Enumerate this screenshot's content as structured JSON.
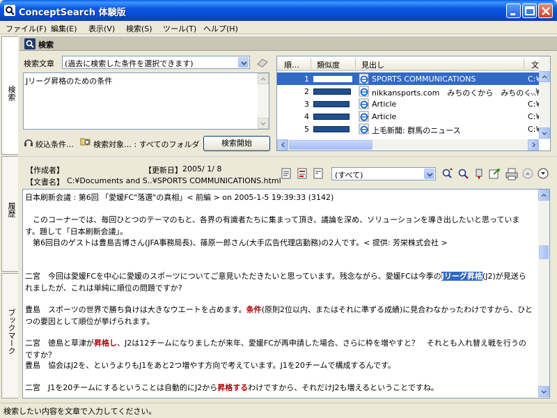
{
  "window": {
    "title": "ConceptSearch 体験版"
  },
  "menu": [
    "ファイル(F)",
    "編集(E)",
    "表示(V)",
    "検索(S)",
    "ツール(T)",
    "ヘルプ(H)"
  ],
  "side_tabs": {
    "search": "検索",
    "history": "履歴",
    "bookmark": "ブックマーク"
  },
  "panel": {
    "title": "検索"
  },
  "search": {
    "label": "検索文章",
    "history_placeholder": "(過去に検索した条件を選択できます)",
    "query_text": "Jリーグ昇格のための条件",
    "narrow_label": "絞込条件…",
    "target_label": "検索対象… : すべてのフォルダ",
    "start_button": "検索開始"
  },
  "results": {
    "columns": [
      "順…",
      "類似度",
      "見出し",
      "文"
    ],
    "rows": [
      {
        "rank": "1",
        "similarity": 1.0,
        "headline": "SPORTS COMMUNICATIONS",
        "doc": "C:¥",
        "selected": true
      },
      {
        "rank": "2",
        "similarity": 0.96,
        "headline": "nikkansports.com　みちのくから　みちのく…",
        "doc": "…¥"
      },
      {
        "rank": "3",
        "similarity": 0.92,
        "headline": "Article",
        "doc": "C:¥"
      },
      {
        "rank": "4",
        "similarity": 0.92,
        "headline": "Article",
        "doc": "C:¥"
      },
      {
        "rank": "5",
        "similarity": 0.92,
        "headline": "上毛新聞: 群馬のニュース",
        "doc": "C:¥"
      }
    ]
  },
  "docinfo": {
    "author_label": "【作成者】",
    "updated_label": "【更新日】",
    "updated_value": "2005/ 1/ 8",
    "docname_label": "【文書名】",
    "docname_value": "C:¥Documents and S..¥SPORTS COMMUNICATIONS.html"
  },
  "viewer": {
    "filter_value": "(すべて)"
  },
  "document": {
    "lines": [
      "日本刷新会議 : 第6回 「愛媛FC\"落選\"の真相」< 前編 > on 2005-1-5 19:39:33 (3142)",
      "　このコーナーでは、毎回ひとつのテーマのもと、各界の有識者たちに集まって頂き、議論を深め、ソリューションを導き出したいと思っています。題して「日本刷新会議」。",
      "　第6回目のゲストは豊島吉博さん(JFA事務局長)、篠原一郎さん(大手広告代理店勤務)の2人です。< 提供: 芳栄株式会社 >"
    ],
    "p2_before": "二宮　今回は愛媛FCを中心に愛媛のスポーツについてご意見いただきたいと思っています。残念ながら、愛媛FCは今季の",
    "p2_hl": "Jリーグ昇格",
    "p2_after": "(J2)が見送られましたが、これは単純に順位の問題ですか?",
    "p3_before": "豊島　スポーツの世界で勝ち負けは大きなウエートを占めます。",
    "p3_hl": "条件",
    "p3_after": "(原則2位以内、またはそれに準ずる成績)に見合わなかったわけですから、ひとつの要因として順位が挙げられます。",
    "p4_before": "二宮　徳島と草津が",
    "p4_hl": "昇格し",
    "p4_after": "、J2は12チームになりましたが来年、愛媛FCが再申請した場合、さらに枠を増やすと？　それとも入れ替え戦を行うのですか？",
    "p5": "豊島　協会はJ2を、というよりもJ1をあと2つ増やす方向で考えています。J1を20チームで構成するんです。",
    "p6_before": "二宮　J1を20チームにするということは自動的にJ2から",
    "p6_hl": "昇格する",
    "p6_after": "わけですから、それだけJ2も増えるということですね。"
  },
  "status": {
    "text": "検索したい内容を文章で入力してください。"
  },
  "colors": {
    "titlebar": "#0a58e0",
    "selection": "#316ac5",
    "highlight_red": "#b0000a"
  }
}
